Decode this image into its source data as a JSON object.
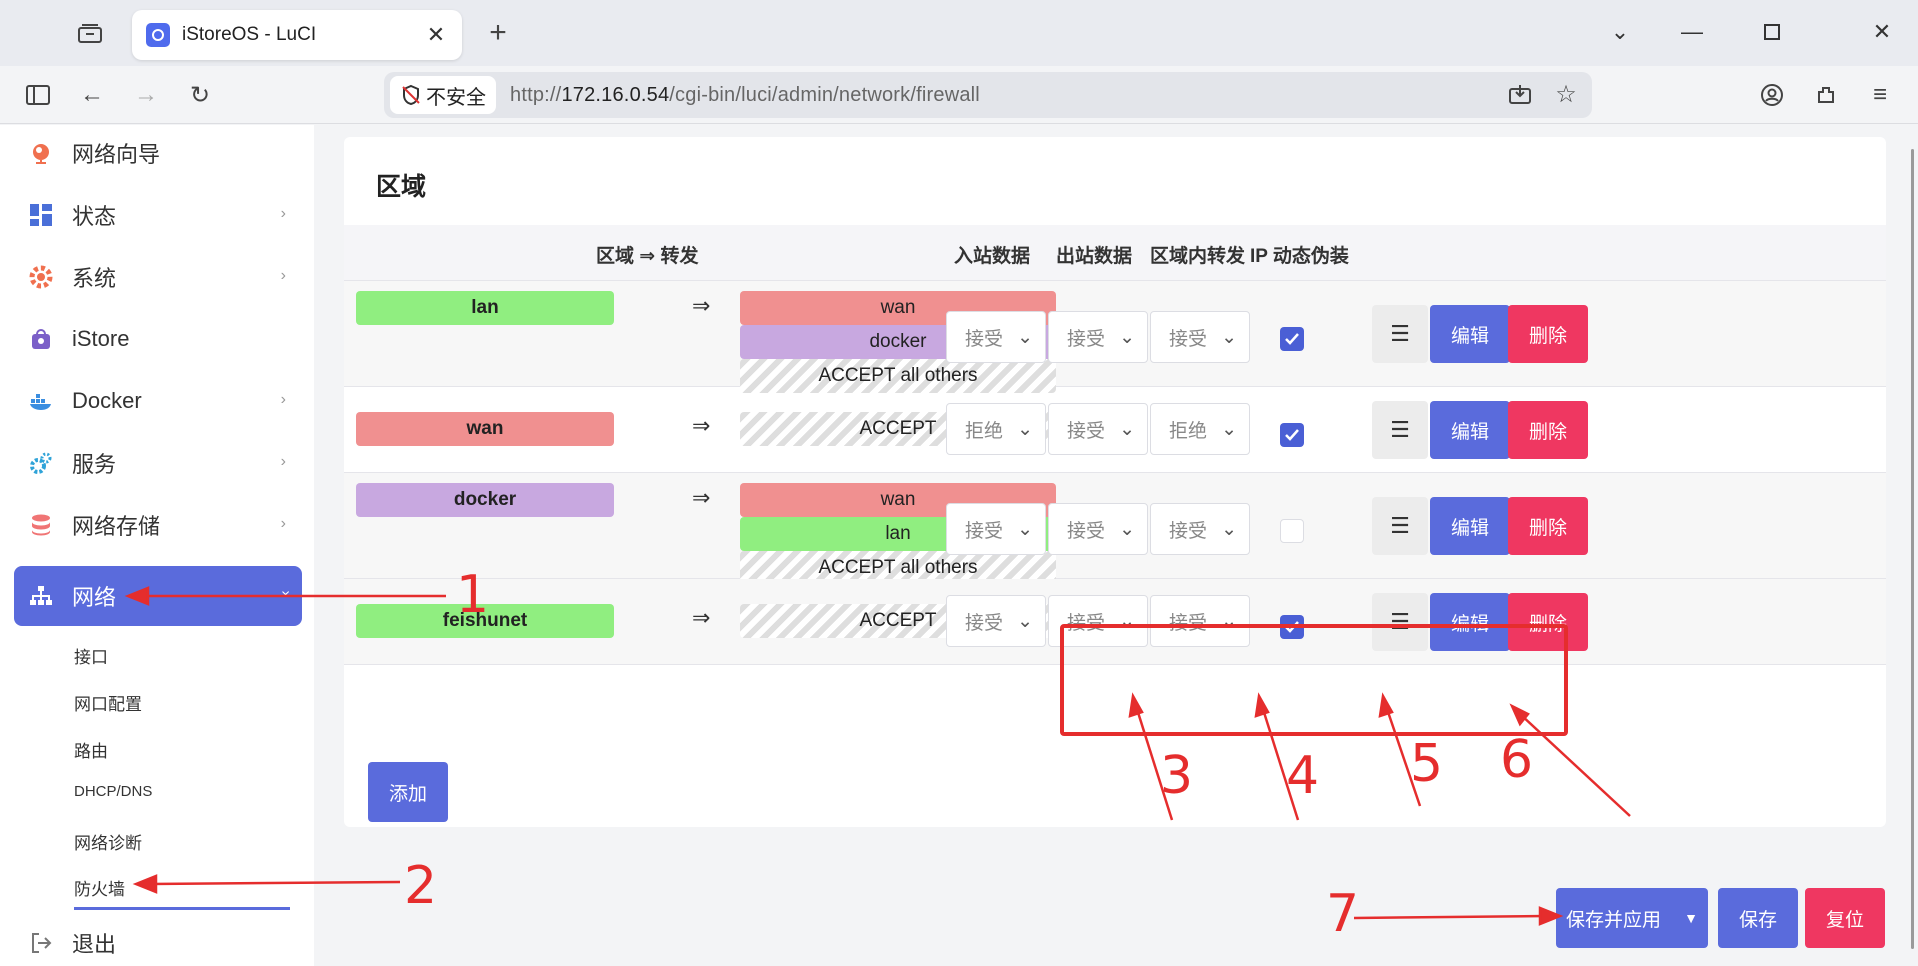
{
  "browser": {
    "tab_title": "iStoreOS - LuCI",
    "security_label": "不安全",
    "url_prefix": "http://",
    "url_host": "172.16.0.54",
    "url_path": "/cgi-bin/luci/admin/network/firewall"
  },
  "sidebar": {
    "items": [
      {
        "label": "网络向导",
        "icon": "globe-icon"
      },
      {
        "label": "状态",
        "icon": "dashboard-icon"
      },
      {
        "label": "系统",
        "icon": "gear-icon"
      },
      {
        "label": "iStore",
        "icon": "store-icon"
      },
      {
        "label": "Docker",
        "icon": "docker-icon"
      },
      {
        "label": "服务",
        "icon": "services-icon"
      },
      {
        "label": "网络存储",
        "icon": "storage-icon"
      },
      {
        "label": "网络",
        "icon": "network-icon"
      },
      {
        "label": "退出",
        "icon": "logout-icon"
      }
    ],
    "sub_items": [
      "接口",
      "网口配置",
      "路由",
      "DHCP/DNS",
      "网络诊断",
      "防火墙"
    ]
  },
  "zones": {
    "title": "区域",
    "headers": {
      "forward": "区域 ⇒ 转发",
      "input": "入站数据",
      "output": "出站数据",
      "intra": "区域内转发",
      "masq": "IP 动态伪装"
    },
    "arrow": "⇒",
    "rows": [
      {
        "zone": "lan",
        "forwards": [
          "wan",
          "docker",
          "ACCEPT all others"
        ],
        "input": "接受",
        "output": "接受",
        "intra": "接受",
        "masq": true
      },
      {
        "zone": "wan",
        "forwards": [
          "ACCEPT"
        ],
        "input": "拒绝",
        "output": "接受",
        "intra": "拒绝",
        "masq": true
      },
      {
        "zone": "docker",
        "forwards": [
          "wan",
          "lan",
          "ACCEPT all others"
        ],
        "input": "接受",
        "output": "接受",
        "intra": "接受",
        "masq": false
      },
      {
        "zone": "feishunet",
        "forwards": [
          "ACCEPT"
        ],
        "input": "接受",
        "output": "接受",
        "intra": "接受",
        "masq": true
      }
    ],
    "menu_glyph": "☰",
    "edit_label": "编辑",
    "delete_label": "删除",
    "add_label": "添加"
  },
  "footer": {
    "save_apply_label": "保存并应用",
    "save_label": "保存",
    "reset_label": "复位"
  },
  "annotations": [
    "1",
    "2",
    "3",
    "4",
    "5",
    "6",
    "7"
  ],
  "colors": {
    "accent": "#5a6bdc",
    "danger": "#ef3761",
    "annotation": "#e52d2d",
    "zone_lan": "#90ee80",
    "zone_wan": "#f09090",
    "zone_docker": "#c8a8e0",
    "zone_feishunet": "#90ee80"
  }
}
